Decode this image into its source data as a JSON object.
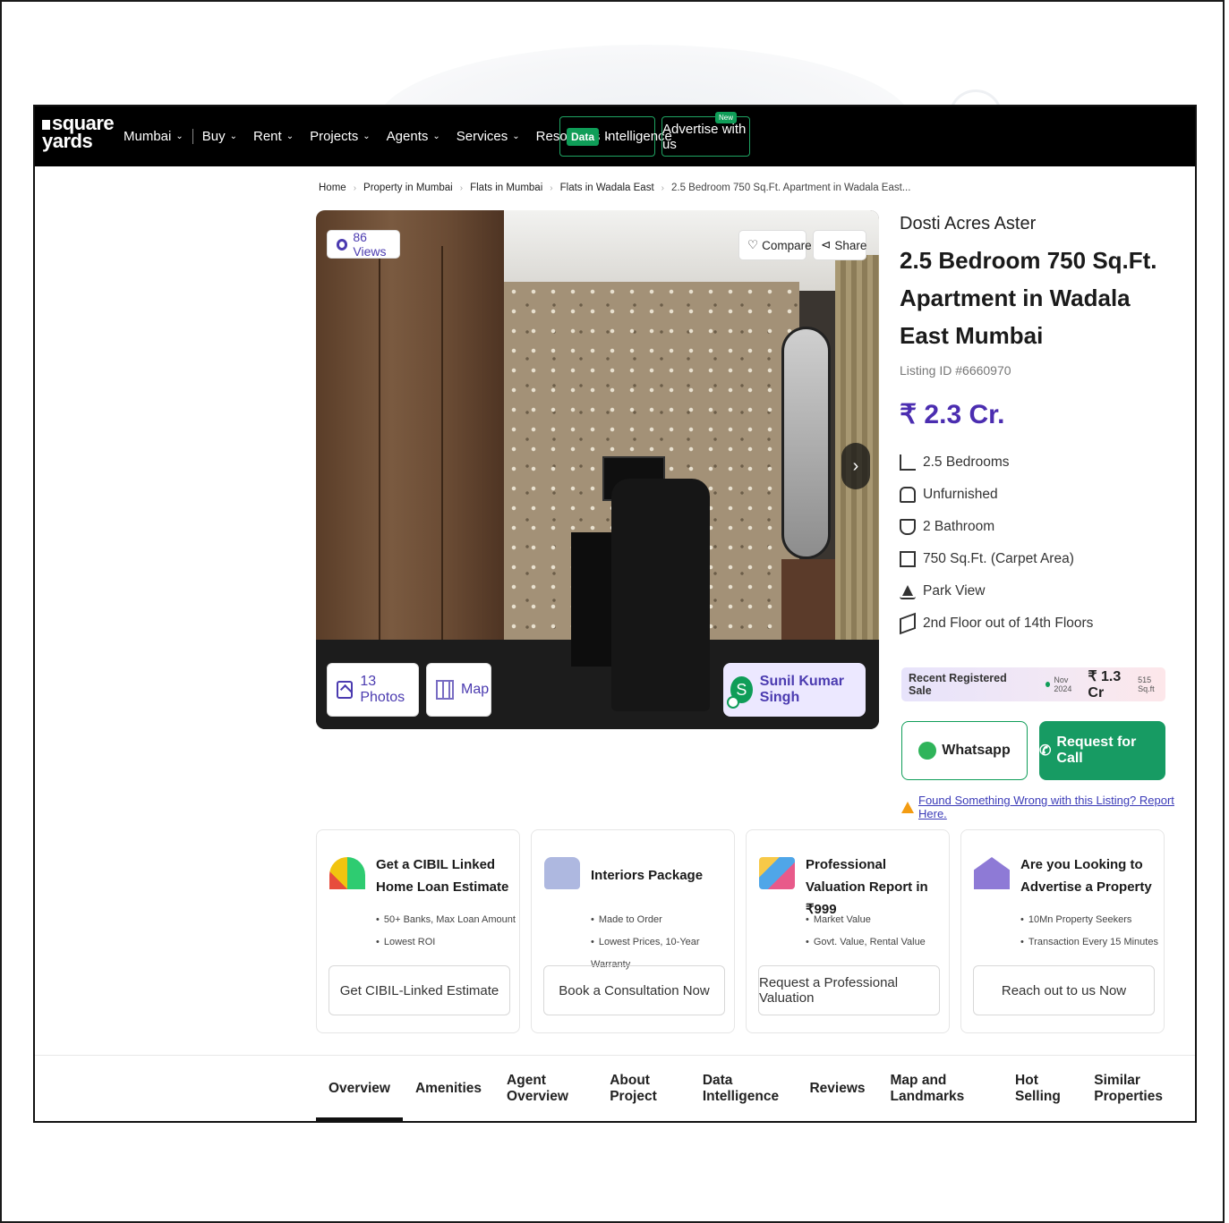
{
  "nav": {
    "logo_line1": "square",
    "logo_line2": "yards",
    "items": [
      {
        "label": "Mumbai"
      },
      {
        "label": "Buy"
      },
      {
        "label": "Rent"
      },
      {
        "label": "Projects"
      },
      {
        "label": "Agents"
      },
      {
        "label": "Services"
      },
      {
        "label": "Resources"
      }
    ],
    "data_intel_tag": "Data",
    "data_intel_label": "Intelligence",
    "advertise_label": "Advertise with us",
    "advertise_badge": "New"
  },
  "breadcrumb": [
    "Home",
    "Property in Mumbai",
    "Flats in Mumbai",
    "Flats in Wadala East",
    "2.5 Bedroom 750 Sq.Ft. Apartment in Wadala East..."
  ],
  "gallery": {
    "views": "86 Views",
    "compare": "Compare",
    "share": "Share",
    "photos": "13 Photos",
    "map": "Map",
    "agent_initial": "S",
    "agent_name": "Sunil Kumar Singh"
  },
  "listing": {
    "project_name": "Dosti Acres Aster",
    "title": "2.5 Bedroom 750 Sq.Ft. Apartment in Wadala East Mumbai",
    "listing_id": "Listing ID #6660970",
    "price": "₹ 2.3 Cr.",
    "features": [
      {
        "icon": "bed-icon",
        "text": "2.5 Bedrooms"
      },
      {
        "icon": "sofa-icon",
        "text": "Unfurnished"
      },
      {
        "icon": "bathtub-icon",
        "text": "2 Bathroom"
      },
      {
        "icon": "area-icon",
        "text": "750 Sq.Ft. (Carpet Area)"
      },
      {
        "icon": "park-icon",
        "text": "Park View"
      },
      {
        "icon": "floor-icon",
        "text": "2nd Floor out of 14th Floors"
      }
    ],
    "recent_sale_label": "Recent Registered Sale",
    "recent_sale_date": "Nov 2024",
    "recent_sale_price": "₹ 1.3 Cr",
    "recent_sale_area": "515 Sq.ft",
    "whatsapp_label": "Whatsapp",
    "call_label": "Request for Call",
    "report_text": "Found Something Wrong with this Listing? Report Here."
  },
  "cards": [
    {
      "icon": "gauge-icon",
      "title": "Get a CIBIL Linked Home Loan Estimate",
      "bullets": [
        "50+ Banks, Max Loan Amount",
        "Lowest ROI"
      ],
      "button": "Get CIBIL-Linked Estimate"
    },
    {
      "icon": "sofa-icon",
      "title": "Interiors Package",
      "bullets": [
        "Made to Order",
        "Lowest Prices, 10-Year Warranty"
      ],
      "button": "Book a Consultation Now"
    },
    {
      "icon": "report-icon",
      "title": "Professional Valuation Report in ₹999",
      "bullets": [
        "Market Value",
        "Govt. Value, Rental Value"
      ],
      "button": "Request a Professional Valuation"
    },
    {
      "icon": "house-icon",
      "title": "Are you Looking to Advertise a Property",
      "bullets": [
        "10Mn Property Seekers",
        "Transaction Every 15 Minutes"
      ],
      "button": "Reach out to us Now"
    }
  ],
  "tabs": [
    "Overview",
    "Amenities",
    "Agent Overview",
    "About Project",
    "Data Intelligence",
    "Reviews",
    "Map and Landmarks",
    "Hot Selling",
    "Similar Properties"
  ]
}
